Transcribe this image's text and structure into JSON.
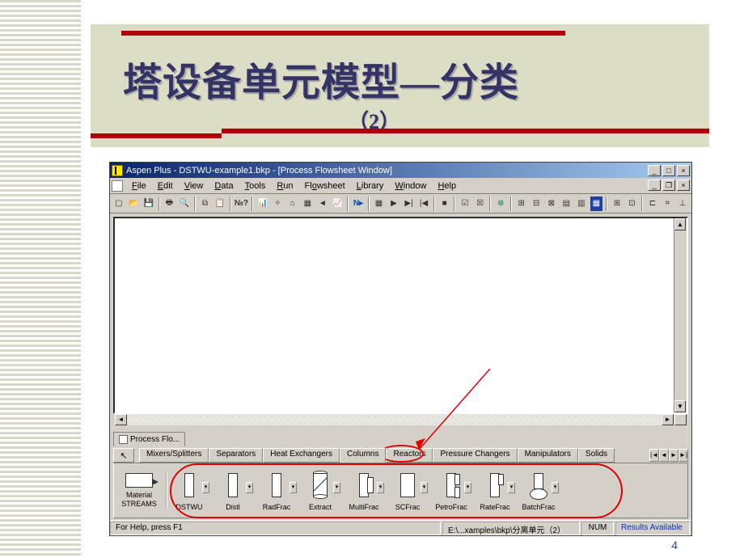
{
  "slide": {
    "title": "塔设备单元模型—分类",
    "subtitle": "（2）",
    "page_number": "4"
  },
  "app": {
    "title": "Aspen Plus - DSTWU-example1.bkp - [Process Flowsheet Window]",
    "menu": [
      "File",
      "Edit",
      "View",
      "Data",
      "Tools",
      "Run",
      "Flowsheet",
      "Library",
      "Window",
      "Help"
    ],
    "mdi_tab": "Process Flo...",
    "palette_tool_icon": "arrow-cursor-icon",
    "palette_tabs": [
      "Mixers/Splitters",
      "Separators",
      "Heat Exchangers",
      "Columns",
      "Reactors",
      "Pressure Changers",
      "Manipulators",
      "Solids"
    ],
    "palette_active_tab": "Columns",
    "palette_left": {
      "line1": "Material",
      "line2": "STREAMS"
    },
    "palette_items": [
      "DSTWU",
      "Distl",
      "RadFrac",
      "Extract",
      "MultiFrac",
      "SCFrac",
      "PetroFrac",
      "RateFrac",
      "BatchFrac"
    ],
    "status": {
      "help": "For Help, press F1",
      "path": "E:\\...xamples\\bkp\\分离单元（2）",
      "num": "NUM",
      "results": "Results Available"
    }
  }
}
